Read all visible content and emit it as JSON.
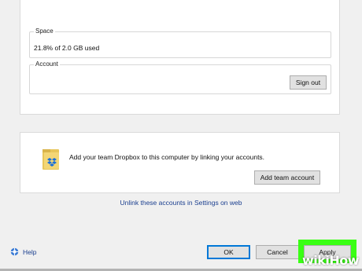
{
  "space": {
    "legend": "Space",
    "usage": "21.8% of 2.0 GB used"
  },
  "account": {
    "legend": "Account",
    "sign_out_label": "Sign out"
  },
  "team": {
    "message": "Add your team Dropbox to this computer by linking your accounts.",
    "add_team_label": "Add team account",
    "icon": "dropbox-folder-icon"
  },
  "unlink_link": "Unlink these accounts in Settings on web",
  "footer": {
    "help_label": "Help",
    "help_icon": "lifebuoy-help-icon",
    "ok_label": "OK",
    "cancel_label": "Cancel",
    "apply_label": "Apply"
  },
  "watermark": {
    "wiki": "wiki",
    "how": "How"
  },
  "colors": {
    "background": "#f0f0f0",
    "link": "#1b3f8f",
    "ok_border": "#0078d7",
    "highlight": "#39ff14"
  }
}
